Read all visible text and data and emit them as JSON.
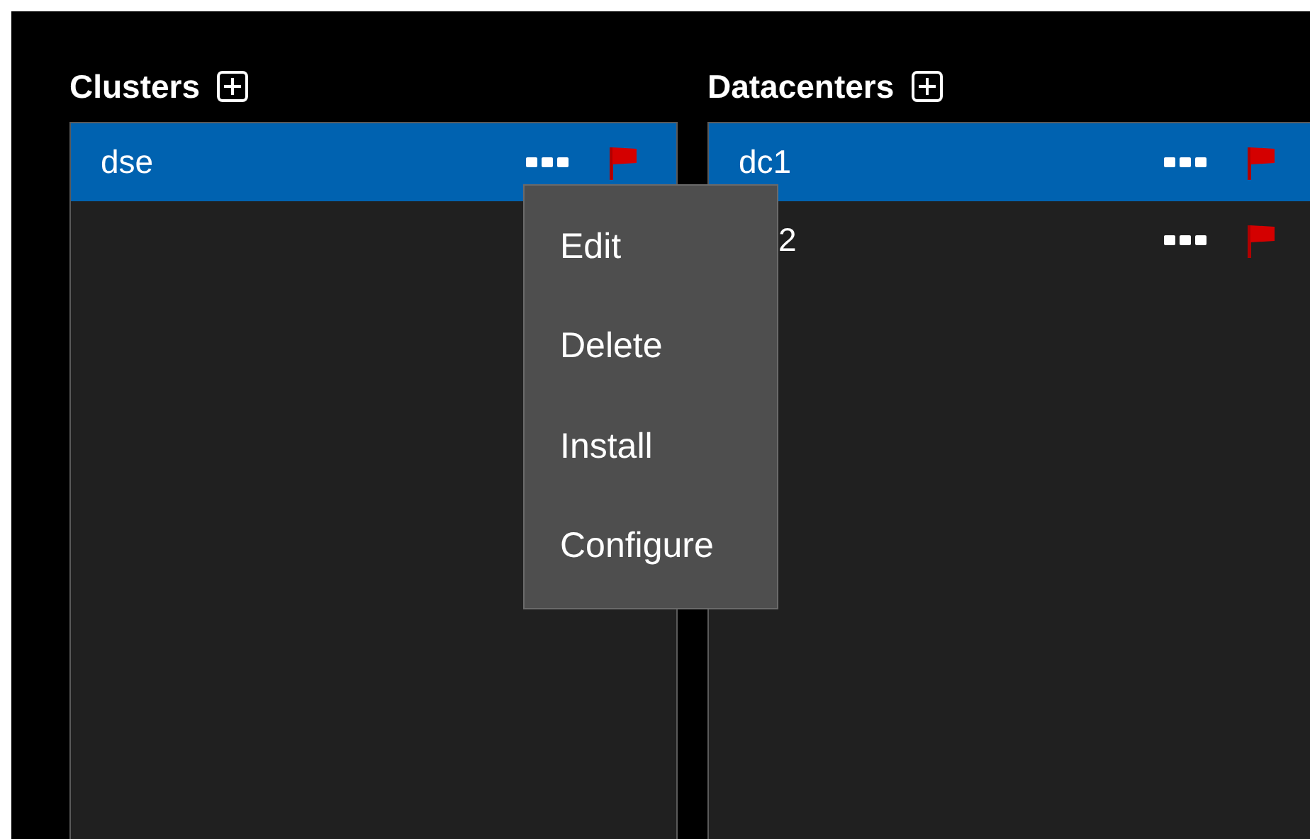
{
  "panels": [
    {
      "title": "Clusters",
      "rows": [
        {
          "label": "dse",
          "selected": true,
          "covered": false
        }
      ]
    },
    {
      "title": "Datacenters",
      "rows": [
        {
          "label": "dc1",
          "selected": true,
          "covered": false
        },
        {
          "label": "2",
          "selected": false,
          "covered": true
        }
      ]
    }
  ],
  "context_menu": {
    "items": [
      "Edit",
      "Delete",
      "Install",
      "Configure"
    ]
  }
}
